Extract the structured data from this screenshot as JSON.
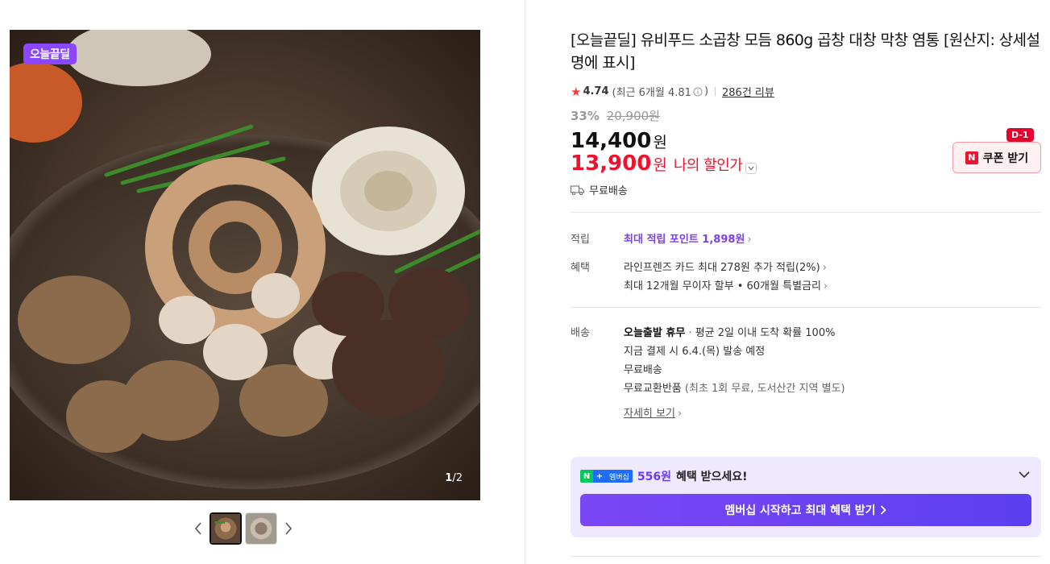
{
  "gallery": {
    "badge": "오늘끝딜",
    "counter_current": "1",
    "counter_total": "/2",
    "prev_label": "‹",
    "next_label": "›"
  },
  "product": {
    "title": "[오늘끝딜] 유비푸드 소곱창 모듬 860g 곱창 대창 막창 염통 [원산지: 상세설명에 표시]",
    "rating": "4.74",
    "recent_rating": "(최근 6개월 4.81",
    "recent_rating_close": ")",
    "reviews": "286건 리뷰",
    "discount_pct": "33%",
    "original_price": "20,900원",
    "price": "14,400",
    "price_unit": "원",
    "my_price": "13,900",
    "my_price_unit": "원",
    "my_price_label": "나의 할인가",
    "shipping": "무료배송"
  },
  "coupon": {
    "dday": "D-1",
    "logo": "N",
    "label": "쿠폰 받기"
  },
  "details": {
    "points_label": "적립",
    "points_value": "최대 적립 포인트 1,898원",
    "benefit_label": "혜택",
    "benefit_1": "라인프렌즈 카드 최대 278원 추가 적립(2%)",
    "benefit_2": "최대 12개월 무이자 할부 • 60개월 특별금리",
    "delivery_label": "배송",
    "delivery_title": "오늘출발 휴무",
    "delivery_avg": "평균 2일 이내 도착 확률 100%",
    "delivery_2": "지금 결제 시 6.4.(목) 발송 예정",
    "delivery_3": "무료배송",
    "delivery_4": "무료교환반품",
    "delivery_4_note": "(최초 1회 무료, 도서산간 지역 별도)",
    "more": "자세히 보기"
  },
  "membership": {
    "logo_n": "N",
    "logo_plus": "+",
    "logo_text": "멤버십",
    "amount": "556원",
    "text": "혜택 받으세요!",
    "button": "멤버십 시작하고 최대 혜택 받기"
  },
  "colors": {
    "accent_red": "#f0122d",
    "accent_purple": "#7b3ff2",
    "naver_green": "#03c75a"
  }
}
